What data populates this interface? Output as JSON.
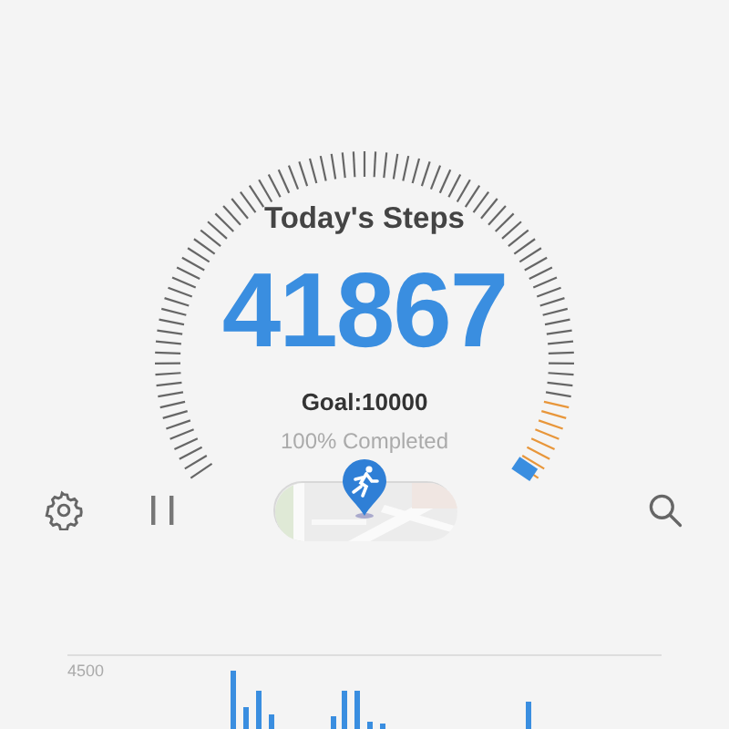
{
  "steps": {
    "title": "Today's Steps",
    "count": "41867",
    "goal": "Goal:10000",
    "progress": "100% Completed"
  },
  "chart": {
    "axis_label": "4500"
  }
}
